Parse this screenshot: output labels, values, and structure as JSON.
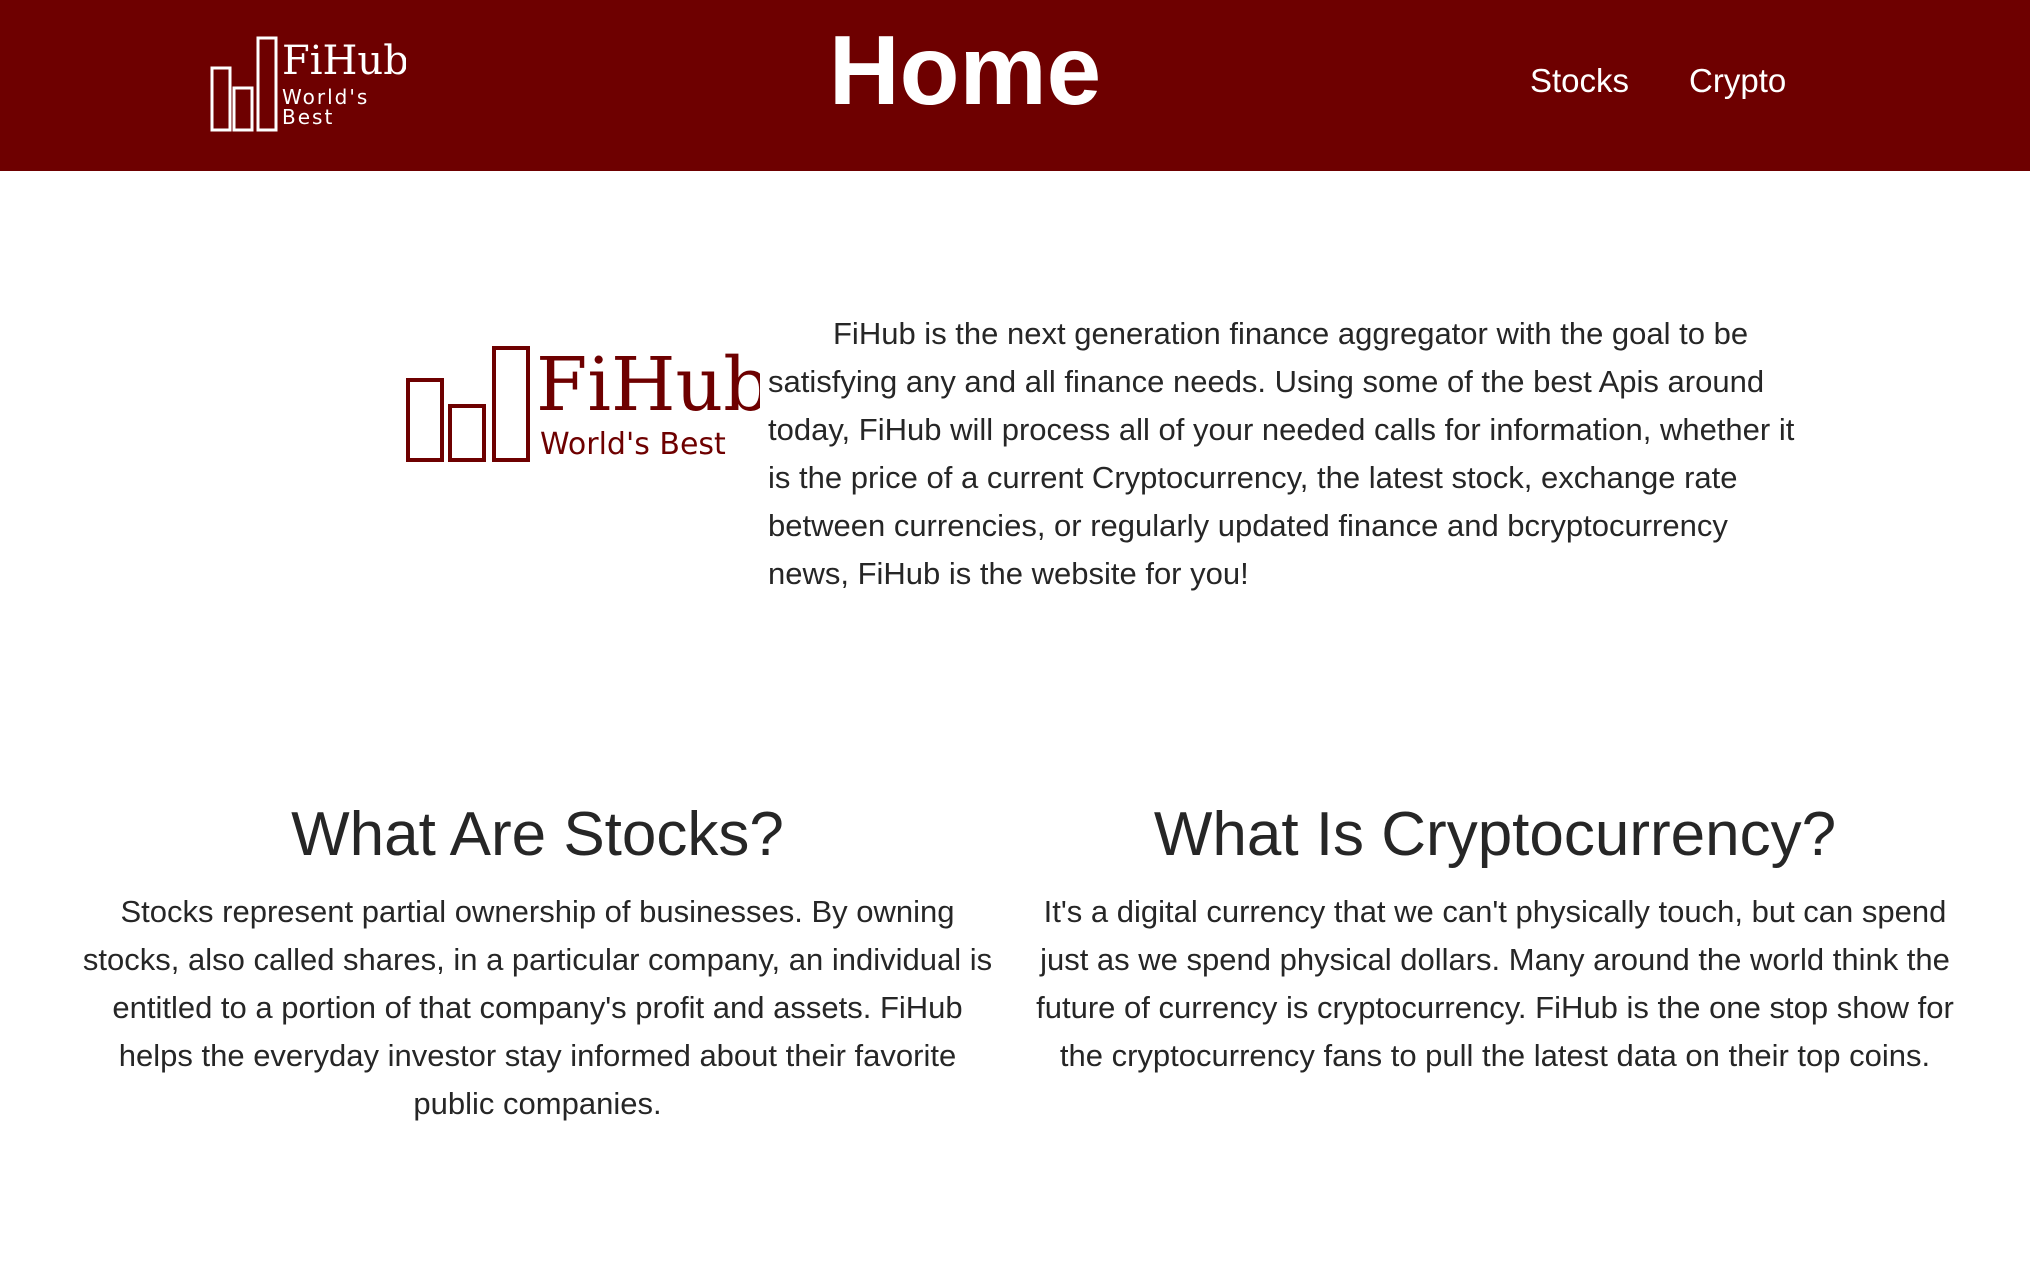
{
  "header": {
    "title": "Home",
    "logo": {
      "name": "FiHub",
      "tagline_line1": "World's",
      "tagline_line2": "Best"
    },
    "nav": [
      {
        "label": "Stocks"
      },
      {
        "label": "Crypto"
      }
    ],
    "background_color": "#6e0000"
  },
  "intro": {
    "logo": {
      "name": "FiHub",
      "tagline": "World's Best"
    },
    "text": "FiHub is the next generation finance aggregator with the goal to be satisfying any and all finance needs. Using some of the best Apis around today, FiHub will process all of your needed calls for information, whether it is the price of a current Cryptocurrency, the latest stock, exchange rate between currencies, or regularly updated finance and bcryptocurrency news, FiHub is the website for you!"
  },
  "sections": [
    {
      "heading": "What Are Stocks?",
      "body": "Stocks represent partial ownership of businesses. By owning stocks, also called shares, in a particular company, an individual is entitled to a portion of that company's profit and assets. FiHub helps the everyday investor stay informed about their favorite public companies."
    },
    {
      "heading": "What Is Cryptocurrency?",
      "body": "It's a digital currency that we can't physically touch, but can spend just as we spend physical dollars. Many around the world think the future of currency is cryptocurrency. FiHub is the one stop show for the cryptocurrency fans to pull the latest data on their top coins."
    }
  ],
  "colors": {
    "brand": "#6e0000",
    "text": "#262626",
    "background": "#ffffff"
  }
}
